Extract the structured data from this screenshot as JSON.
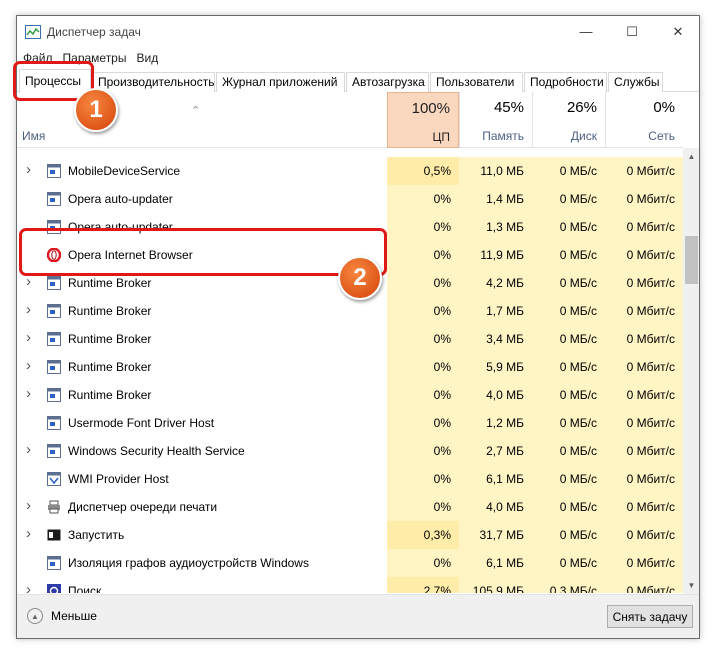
{
  "window": {
    "title": "Диспетчер задач"
  },
  "menu": [
    "Файл",
    "Параметры",
    "Вид"
  ],
  "tabs": [
    "Процессы",
    "Производительность",
    "Журнал приложений",
    "Автозагрузка",
    "Пользователи",
    "Подробности",
    "Службы"
  ],
  "active_tab": "Процессы",
  "columns": {
    "name": "Имя",
    "cpu": {
      "pct": "100%",
      "label": "ЦП"
    },
    "memory": {
      "pct": "45%",
      "label": "Память"
    },
    "disk": {
      "pct": "26%",
      "label": "Диск"
    },
    "network": {
      "pct": "0%",
      "label": "Сеть"
    }
  },
  "processes": [
    {
      "name": "MobileDeviceService",
      "cpu": "0,5%",
      "mem": "11,0 МБ",
      "disk": "0 МБ/с",
      "net": "0 Мбит/с",
      "expandable": true,
      "icon": "window-icon"
    },
    {
      "name": "Opera auto-updater",
      "cpu": "0%",
      "mem": "1,4 МБ",
      "disk": "0 МБ/с",
      "net": "0 Мбит/с",
      "expandable": false,
      "icon": "window-icon"
    },
    {
      "name": "Opera auto-updater",
      "cpu": "0%",
      "mem": "1,3 МБ",
      "disk": "0 МБ/с",
      "net": "0 Мбит/с",
      "expandable": false,
      "icon": "window-icon"
    },
    {
      "name": "Opera Internet Browser",
      "cpu": "0%",
      "mem": "11,9 МБ",
      "disk": "0 МБ/с",
      "net": "0 Мбит/с",
      "expandable": false,
      "icon": "opera-icon"
    },
    {
      "name": "Runtime Broker",
      "cpu": "0%",
      "mem": "4,2 МБ",
      "disk": "0 МБ/с",
      "net": "0 Мбит/с",
      "expandable": true,
      "icon": "window-icon"
    },
    {
      "name": "Runtime Broker",
      "cpu": "0%",
      "mem": "1,7 МБ",
      "disk": "0 МБ/с",
      "net": "0 Мбит/с",
      "expandable": true,
      "icon": "window-icon"
    },
    {
      "name": "Runtime Broker",
      "cpu": "0%",
      "mem": "3,4 МБ",
      "disk": "0 МБ/с",
      "net": "0 Мбит/с",
      "expandable": true,
      "icon": "window-icon"
    },
    {
      "name": "Runtime Broker",
      "cpu": "0%",
      "mem": "5,9 МБ",
      "disk": "0 МБ/с",
      "net": "0 Мбит/с",
      "expandable": true,
      "icon": "window-icon"
    },
    {
      "name": "Runtime Broker",
      "cpu": "0%",
      "mem": "4,0 МБ",
      "disk": "0 МБ/с",
      "net": "0 Мбит/с",
      "expandable": true,
      "icon": "window-icon"
    },
    {
      "name": "Usermode Font Driver Host",
      "cpu": "0%",
      "mem": "1,2 МБ",
      "disk": "0 МБ/с",
      "net": "0 Мбит/с",
      "expandable": false,
      "icon": "window-icon"
    },
    {
      "name": "Windows Security Health Service",
      "cpu": "0%",
      "mem": "2,7 МБ",
      "disk": "0 МБ/с",
      "net": "0 Мбит/с",
      "expandable": true,
      "icon": "window-icon"
    },
    {
      "name": "WMI Provider Host",
      "cpu": "0%",
      "mem": "6,1 МБ",
      "disk": "0 МБ/с",
      "net": "0 Мбит/с",
      "expandable": false,
      "icon": "wmi-icon"
    },
    {
      "name": "Диспетчер очереди печати",
      "cpu": "0%",
      "mem": "4,0 МБ",
      "disk": "0 МБ/с",
      "net": "0 Мбит/с",
      "expandable": true,
      "icon": "printer-icon"
    },
    {
      "name": "Запустить",
      "cpu": "0,3%",
      "mem": "31,7 МБ",
      "disk": "0 МБ/с",
      "net": "0 Мбит/с",
      "expandable": true,
      "icon": "run-icon"
    },
    {
      "name": "Изоляция графов аудиоустройств Windows",
      "cpu": "0%",
      "mem": "6,1 МБ",
      "disk": "0 МБ/с",
      "net": "0 Мбит/с",
      "expandable": false,
      "icon": "window-icon"
    },
    {
      "name": "Поиск",
      "cpu": "2,7%",
      "mem": "105,9 МБ",
      "disk": "0,3 МБ/с",
      "net": "0 Мбит/с",
      "expandable": true,
      "icon": "search-icon"
    }
  ],
  "footer": {
    "fewer_label": "Меньше",
    "end_task_label": "Снять задачу"
  },
  "callouts": [
    "1",
    "2"
  ],
  "colors": {
    "accent": "#e01818",
    "badge": "#e8631e",
    "cpu_header": "#f9d8bf",
    "cell_light": "#fff4c4",
    "cell_mid": "#ffeca8"
  }
}
